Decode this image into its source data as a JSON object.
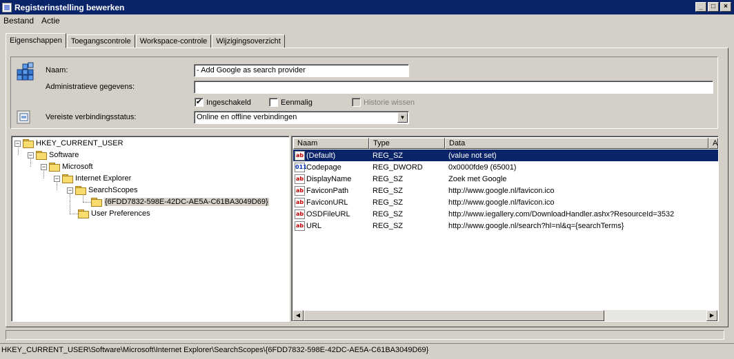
{
  "window": {
    "title": "Registerinstelling bewerken",
    "min": "_",
    "max": "□",
    "close": "×"
  },
  "menu": [
    "Bestand",
    "Actie"
  ],
  "tabs": [
    "Eigenschappen",
    "Toegangscontrole",
    "Workspace-controle",
    "Wijzigingsoverzicht"
  ],
  "props": {
    "name_label": "Naam:",
    "name_value": "- Add Google as search provider",
    "admin_label": "Administratieve gegevens:",
    "admin_value": "",
    "enabled_label": "Ingeschakeld",
    "enabled_checked": "✔",
    "once_label": "Eenmalig",
    "history_label": "Historie wissen",
    "conn_label": "Vereiste verbindingsstatus:",
    "conn_value": "Online en offline verbindingen"
  },
  "tree": [
    {
      "label": "HKEY_CURRENT_USER",
      "exp": "−"
    },
    {
      "label": "Software",
      "exp": "−"
    },
    {
      "label": "Microsoft",
      "exp": "−"
    },
    {
      "label": "Internet Explorer",
      "exp": "−"
    },
    {
      "label": "SearchScopes",
      "exp": "−"
    },
    {
      "label": "{6FDD7832-598E-42DC-AE5A-C61BA3049D69}",
      "exp": ""
    },
    {
      "label": "User Preferences",
      "exp": ""
    }
  ],
  "list": {
    "headers": [
      "Naam",
      "Type",
      "Data",
      "Ac"
    ],
    "rows": [
      {
        "name": "(Default)",
        "type": "REG_SZ",
        "data": "(value not set)",
        "icon": "ab"
      },
      {
        "name": "Codepage",
        "type": "REG_DWORD",
        "data": "0x0000fde9 (65001)",
        "icon": "011"
      },
      {
        "name": "DisplayName",
        "type": "REG_SZ",
        "data": "Zoek met Google",
        "icon": "ab"
      },
      {
        "name": "FaviconPath",
        "type": "REG_SZ",
        "data": "http://www.google.nl/favicon.ico",
        "icon": "ab"
      },
      {
        "name": "FaviconURL",
        "type": "REG_SZ",
        "data": "http://www.google.nl/favicon.ico",
        "icon": "ab"
      },
      {
        "name": "OSDFileURL",
        "type": "REG_SZ",
        "data": "http://www.iegallery.com/DownloadHandler.ashx?ResourceId=3532",
        "icon": "ab"
      },
      {
        "name": "URL",
        "type": "REG_SZ",
        "data": "http://www.google.nl/search?hl=nl&q={searchTerms}",
        "icon": "ab"
      }
    ]
  },
  "scroll": {
    "left": "◀",
    "right": "▶"
  },
  "status": "HKEY_CURRENT_USER\\Software\\Microsoft\\Internet Explorer\\SearchScopes\\{6FDD7832-598E-42DC-AE5A-C61BA3049D69}"
}
